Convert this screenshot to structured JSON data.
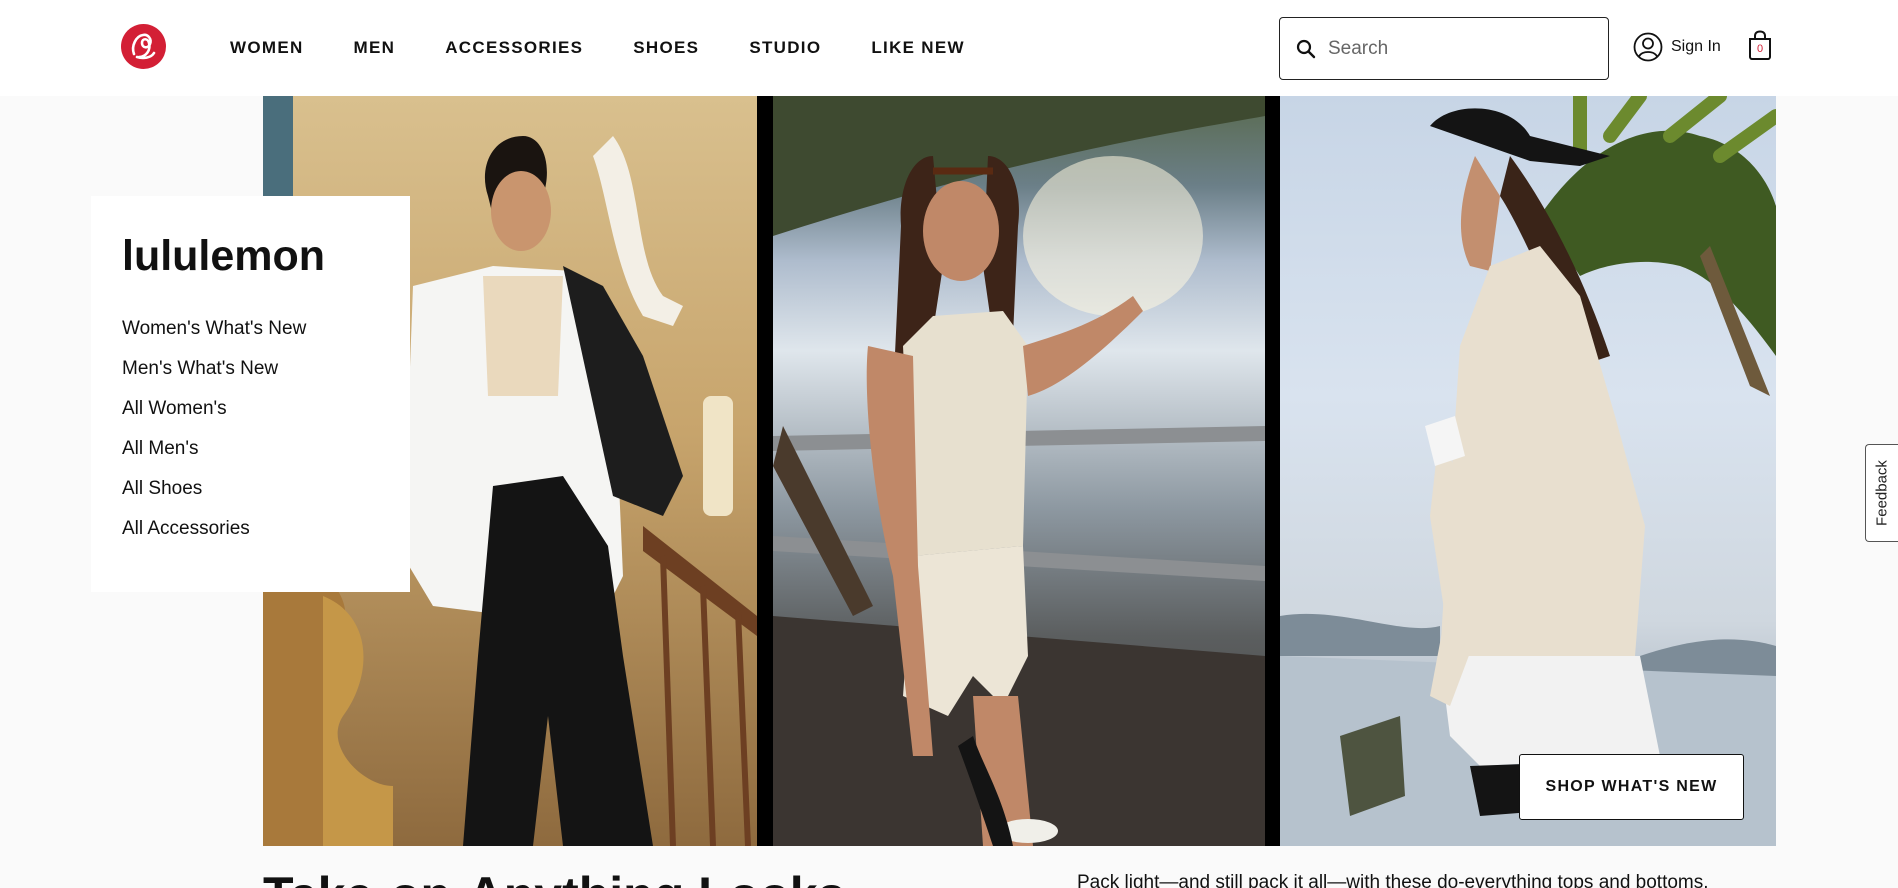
{
  "header": {
    "nav": [
      "WOMEN",
      "MEN",
      "ACCESSORIES",
      "SHOES",
      "STUDIO",
      "LIKE NEW"
    ],
    "search_placeholder": "Search",
    "signin_label": "Sign In",
    "cart_count": "0"
  },
  "card": {
    "brand": "lululemon",
    "links": [
      "Women's What's New",
      "Men's What's New",
      "All Women's",
      "All Men's",
      "All Shoes",
      "All Accessories"
    ]
  },
  "hero": {
    "cta_label": "SHOP WHAT'S NEW"
  },
  "feedback_label": "Feedback",
  "section": {
    "headline": "Take-on-Anything Looks",
    "subcopy": "Pack light—and still pack it all—with these do-everything tops and bottoms."
  },
  "colors": {
    "brand_red": "#d31f35",
    "text": "#111111",
    "page_bg": "#fafafa"
  },
  "icons": [
    "lululemon-logo-icon",
    "search-icon",
    "user-icon",
    "shopping-bag-icon"
  ]
}
